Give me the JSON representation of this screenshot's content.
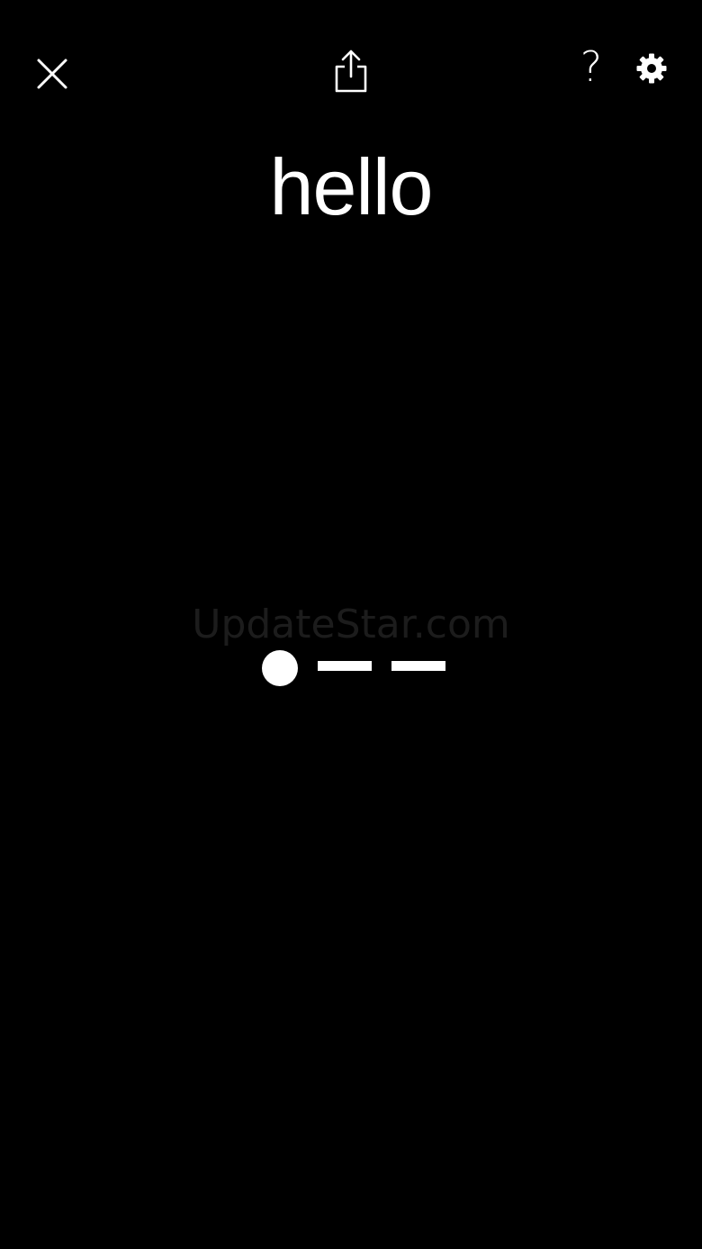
{
  "toolbar": {
    "close_icon": "close-icon",
    "share_icon": "share-icon",
    "help_label": "?",
    "settings_icon": "gear-icon"
  },
  "main": {
    "word": "hello",
    "morse": [
      "dot",
      "dash",
      "dash"
    ]
  },
  "watermark": {
    "text": "UpdateStar.com"
  },
  "colors": {
    "background": "#000000",
    "foreground": "#ffffff"
  }
}
